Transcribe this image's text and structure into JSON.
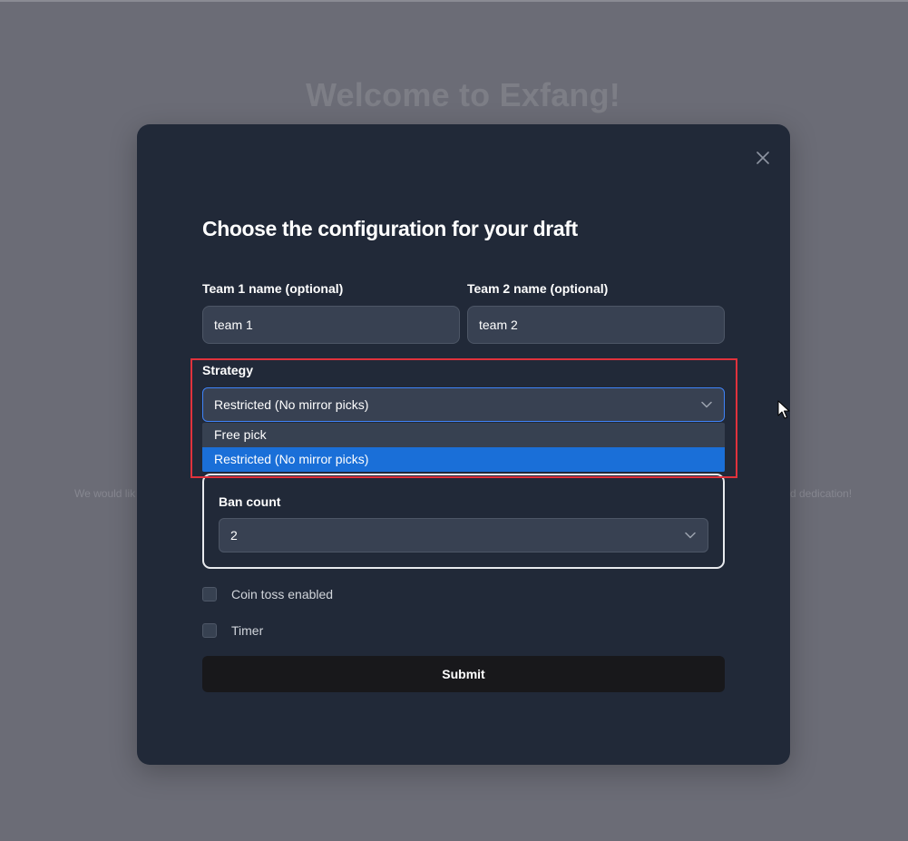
{
  "background": {
    "title": "Welcome to Exfang!",
    "text_left_fragment": "We would lik",
    "text_right_fragment": "d dedication!"
  },
  "modal": {
    "title": "Choose the configuration for your draft",
    "close_icon": "close-icon",
    "team1": {
      "label": "Team 1 name (optional)",
      "value": "team 1"
    },
    "team2": {
      "label": "Team 2 name (optional)",
      "value": "team 2"
    },
    "strategy": {
      "label": "Strategy",
      "selected": "Restricted (No mirror picks)",
      "options": [
        "Free pick",
        "Restricted (No mirror picks)"
      ],
      "chevron_icon": "chevron-down-icon"
    },
    "ban_count": {
      "label": "Ban count",
      "selected": "2",
      "chevron_icon": "chevron-down-icon"
    },
    "coin_toss": {
      "label": "Coin toss enabled",
      "checked": false
    },
    "timer": {
      "label": "Timer",
      "checked": false
    },
    "submit_label": "Submit"
  },
  "colors": {
    "overlay": "#6b6c76",
    "modal_bg": "#212938",
    "input_bg": "#384152",
    "selected_option": "#1a6fd8",
    "focus_border": "#3f83f8",
    "highlight_border": "#e0323c",
    "submit_bg": "#18181b"
  }
}
